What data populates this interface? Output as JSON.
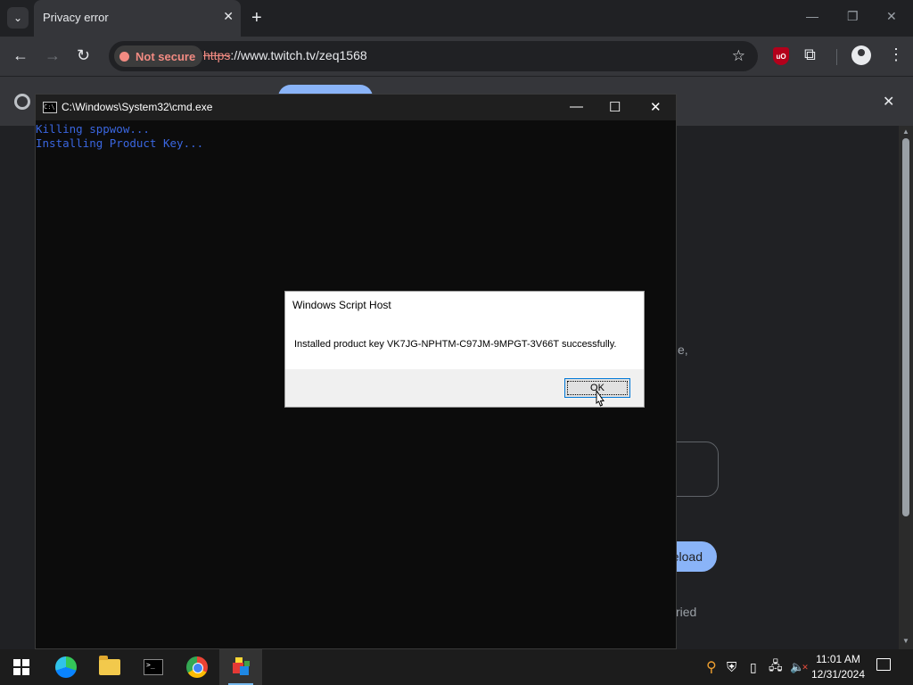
{
  "browser": {
    "tab_title": "Privacy error",
    "security_chip": "Not secure",
    "url_scheme": "https",
    "url_rest": "://www.twitch.tv/zeq1568",
    "accent": "#8ab4f8",
    "warning_color": "#f28b82"
  },
  "page": {
    "fragment_1": "e,",
    "reload_fragment": "eload",
    "fragment_2": "ried"
  },
  "cmd": {
    "title": "C:\\Windows\\System32\\cmd.exe",
    "lines": [
      "Killing sppwow...",
      "Installing Product Key..."
    ],
    "text_color": "#3a66e0"
  },
  "dialog": {
    "title": "Windows Script Host",
    "message": "Installed product key VK7JG-NPHTM-C97JM-9MPGT-3V66T successfully.",
    "ok_label": "OK"
  },
  "taskbar": {
    "apps": [
      "start-icon",
      "edge-icon",
      "file-explorer-icon",
      "terminal-icon",
      "chrome-icon",
      "script-app-icon"
    ],
    "time": "11:01 AM",
    "date": "12/31/2024"
  }
}
